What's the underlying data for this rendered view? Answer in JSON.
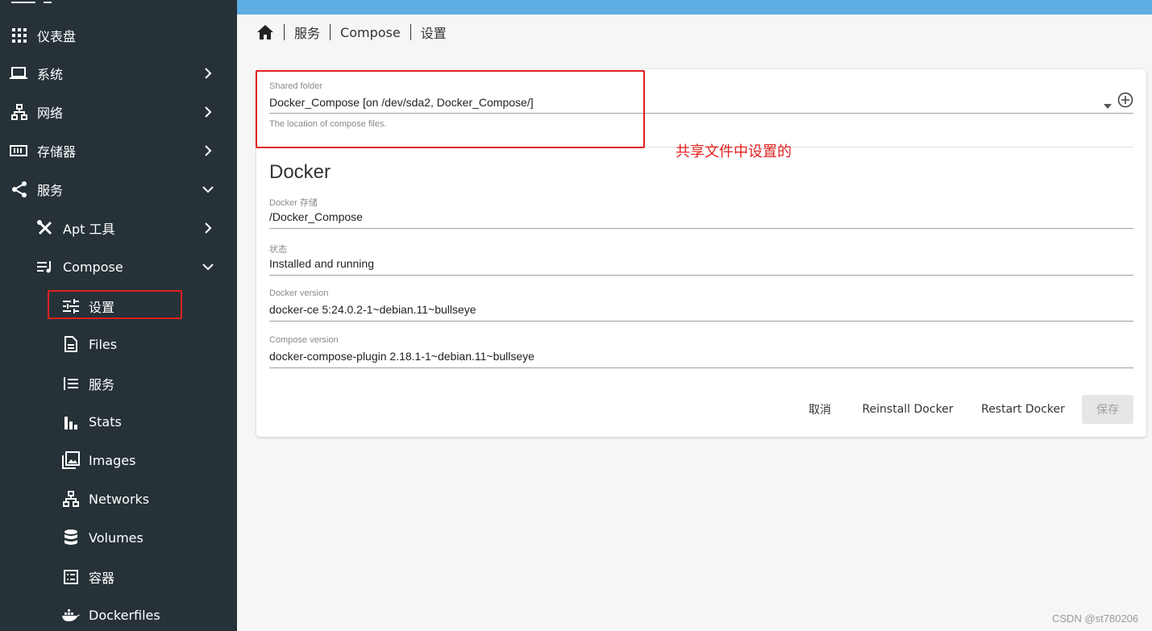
{
  "sidebar": {
    "items": [
      {
        "label": "仪表盘",
        "icon": "apps-grid-icon",
        "expand": "none"
      },
      {
        "label": "系统",
        "icon": "laptop-icon",
        "expand": "right"
      },
      {
        "label": "网络",
        "icon": "network-icon",
        "expand": "right"
      },
      {
        "label": "存储器",
        "icon": "storage-icon",
        "expand": "right"
      },
      {
        "label": "服务",
        "icon": "share-icon",
        "expand": "down"
      },
      {
        "label": "Apt 工具",
        "icon": "tools-icon",
        "expand": "right"
      },
      {
        "label": "Compose",
        "icon": "compose-icon",
        "expand": "down"
      },
      {
        "label": "设置",
        "icon": "tune-icon",
        "expand": "none"
      },
      {
        "label": "Files",
        "icon": "file-icon",
        "expand": "none"
      },
      {
        "label": "服务",
        "icon": "list-icon",
        "expand": "none"
      },
      {
        "label": "Stats",
        "icon": "bar-chart-icon",
        "expand": "none"
      },
      {
        "label": "Images",
        "icon": "image-icon",
        "expand": "none"
      },
      {
        "label": "Networks",
        "icon": "network-icon",
        "expand": "none"
      },
      {
        "label": "Volumes",
        "icon": "database-icon",
        "expand": "none"
      },
      {
        "label": "容器",
        "icon": "list-box-icon",
        "expand": "none"
      },
      {
        "label": "Dockerfiles",
        "icon": "docker-icon",
        "expand": "none"
      }
    ]
  },
  "breadcrumb": {
    "home_icon": "home-icon",
    "items": [
      "服务",
      "Compose",
      "设置"
    ]
  },
  "form": {
    "shared_folder": {
      "label": "Shared folder",
      "value": "Docker_Compose [on /dev/sda2, Docker_Compose/]",
      "hint": "The location of compose files."
    },
    "section_title": "Docker",
    "fields": [
      {
        "label": "Docker 存储",
        "value": "/Docker_Compose"
      },
      {
        "label": "状态",
        "value": "Installed and running"
      },
      {
        "label": "Docker version",
        "value": "docker-ce 5:24.0.2-1~debian.11~bullseye"
      },
      {
        "label": "Compose version",
        "value": "docker-compose-plugin 2.18.1-1~debian.11~bullseye"
      }
    ],
    "buttons": {
      "cancel": "取消",
      "reinstall": "Reinstall Docker",
      "restart": "Restart Docker",
      "save": "保存"
    }
  },
  "annotation": "共享文件中设置的",
  "watermark": "CSDN @st780206",
  "colors": {
    "sidebar_bg": "#263238",
    "topbar": "#5dade2",
    "annotation_red": "#e02020"
  }
}
